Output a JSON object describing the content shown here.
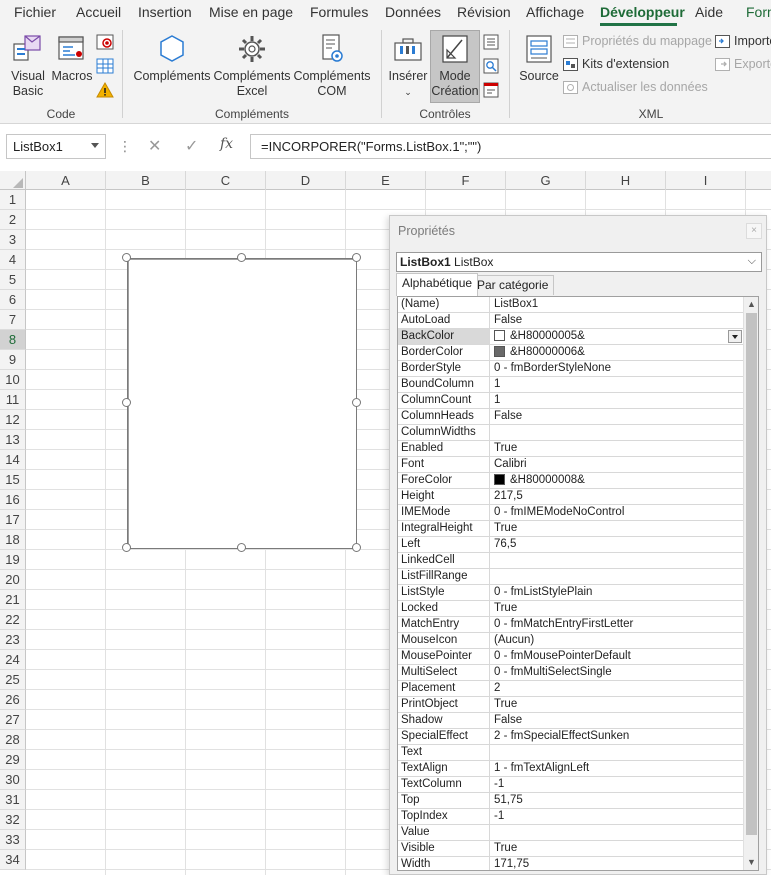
{
  "ribbon_tabs": [
    {
      "label": "Fichier",
      "active": false
    },
    {
      "label": "Accueil",
      "active": false
    },
    {
      "label": "Insertion",
      "active": false
    },
    {
      "label": "Mise en page",
      "active": false
    },
    {
      "label": "Formules",
      "active": false
    },
    {
      "label": "Données",
      "active": false
    },
    {
      "label": "Révision",
      "active": false
    },
    {
      "label": "Affichage",
      "active": false
    },
    {
      "label": "Développeur",
      "active": true
    },
    {
      "label": "Aide",
      "active": false
    },
    {
      "label": "Form",
      "active": false
    }
  ],
  "ribbon": {
    "code": {
      "label": "Code",
      "visual_basic": "Visual Basic",
      "macros": "Macros"
    },
    "complements": {
      "label": "Compléments",
      "complements": "Compléments",
      "complements_excel": "Compléments Excel",
      "complements_com": "Compléments COM"
    },
    "controles": {
      "label": "Contrôles",
      "inserer": "Insérer",
      "mode_creation": "Mode Création"
    },
    "xml": {
      "label": "XML",
      "source": "Source",
      "proprietes_mappage": "Propriétés du mappage",
      "kits_extension": "Kits d'extension",
      "actualiser": "Actualiser les données",
      "importer": "Importer",
      "exporter": "Exporter"
    }
  },
  "formula_bar": {
    "name_box": "ListBox1",
    "function_symbol": "fx",
    "formula": "=INCORPORER(\"Forms.ListBox.1\";\"\")"
  },
  "sheet": {
    "columns": [
      "A",
      "B",
      "C",
      "D",
      "E",
      "F",
      "G",
      "H",
      "I"
    ],
    "rows": [
      "1",
      "2",
      "3",
      "4",
      "5",
      "6",
      "7",
      "8",
      "9",
      "10",
      "11",
      "12",
      "13",
      "14",
      "15",
      "16",
      "17",
      "18",
      "19",
      "20",
      "21",
      "22",
      "23",
      "24",
      "25",
      "26",
      "27",
      "28",
      "29",
      "30",
      "31",
      "32",
      "33",
      "34"
    ],
    "selected_row": "8"
  },
  "properties_window": {
    "title": "Propriétés",
    "close_glyph": "×",
    "object_name": "ListBox1",
    "object_type": "ListBox",
    "tabs": [
      "Alphabétique",
      "Par catégorie"
    ],
    "active_tab": 0,
    "selected_property": "BackColor",
    "properties": [
      {
        "name": "(Name)",
        "value": "ListBox1"
      },
      {
        "name": "AutoLoad",
        "value": "False"
      },
      {
        "name": "BackColor",
        "value": "&H80000005&",
        "swatch": "#ffffff"
      },
      {
        "name": "BorderColor",
        "value": "&H80000006&",
        "swatch": "#696969"
      },
      {
        "name": "BorderStyle",
        "value": "0 - fmBorderStyleNone"
      },
      {
        "name": "BoundColumn",
        "value": "1"
      },
      {
        "name": "ColumnCount",
        "value": "1"
      },
      {
        "name": "ColumnHeads",
        "value": "False"
      },
      {
        "name": "ColumnWidths",
        "value": ""
      },
      {
        "name": "Enabled",
        "value": "True"
      },
      {
        "name": "Font",
        "value": "Calibri"
      },
      {
        "name": "ForeColor",
        "value": "&H80000008&",
        "swatch": "#000000"
      },
      {
        "name": "Height",
        "value": "217,5"
      },
      {
        "name": "IMEMode",
        "value": "0 - fmIMEModeNoControl"
      },
      {
        "name": "IntegralHeight",
        "value": "True"
      },
      {
        "name": "Left",
        "value": "76,5"
      },
      {
        "name": "LinkedCell",
        "value": ""
      },
      {
        "name": "ListFillRange",
        "value": ""
      },
      {
        "name": "ListStyle",
        "value": "0 - fmListStylePlain"
      },
      {
        "name": "Locked",
        "value": "True"
      },
      {
        "name": "MatchEntry",
        "value": "0 - fmMatchEntryFirstLetter"
      },
      {
        "name": "MouseIcon",
        "value": "(Aucun)"
      },
      {
        "name": "MousePointer",
        "value": "0 - fmMousePointerDefault"
      },
      {
        "name": "MultiSelect",
        "value": "0 - fmMultiSelectSingle"
      },
      {
        "name": "Placement",
        "value": "2"
      },
      {
        "name": "PrintObject",
        "value": "True"
      },
      {
        "name": "Shadow",
        "value": "False"
      },
      {
        "name": "SpecialEffect",
        "value": "2 - fmSpecialEffectSunken"
      },
      {
        "name": "Text",
        "value": ""
      },
      {
        "name": "TextAlign",
        "value": "1 - fmTextAlignLeft"
      },
      {
        "name": "TextColumn",
        "value": "-1"
      },
      {
        "name": "Top",
        "value": "51,75"
      },
      {
        "name": "TopIndex",
        "value": "-1"
      },
      {
        "name": "Value",
        "value": ""
      },
      {
        "name": "Visible",
        "value": "True"
      },
      {
        "name": "Width",
        "value": "171,75"
      }
    ]
  },
  "colors": {
    "accent": "#217346",
    "active_tab_text": "#1e6b37"
  }
}
